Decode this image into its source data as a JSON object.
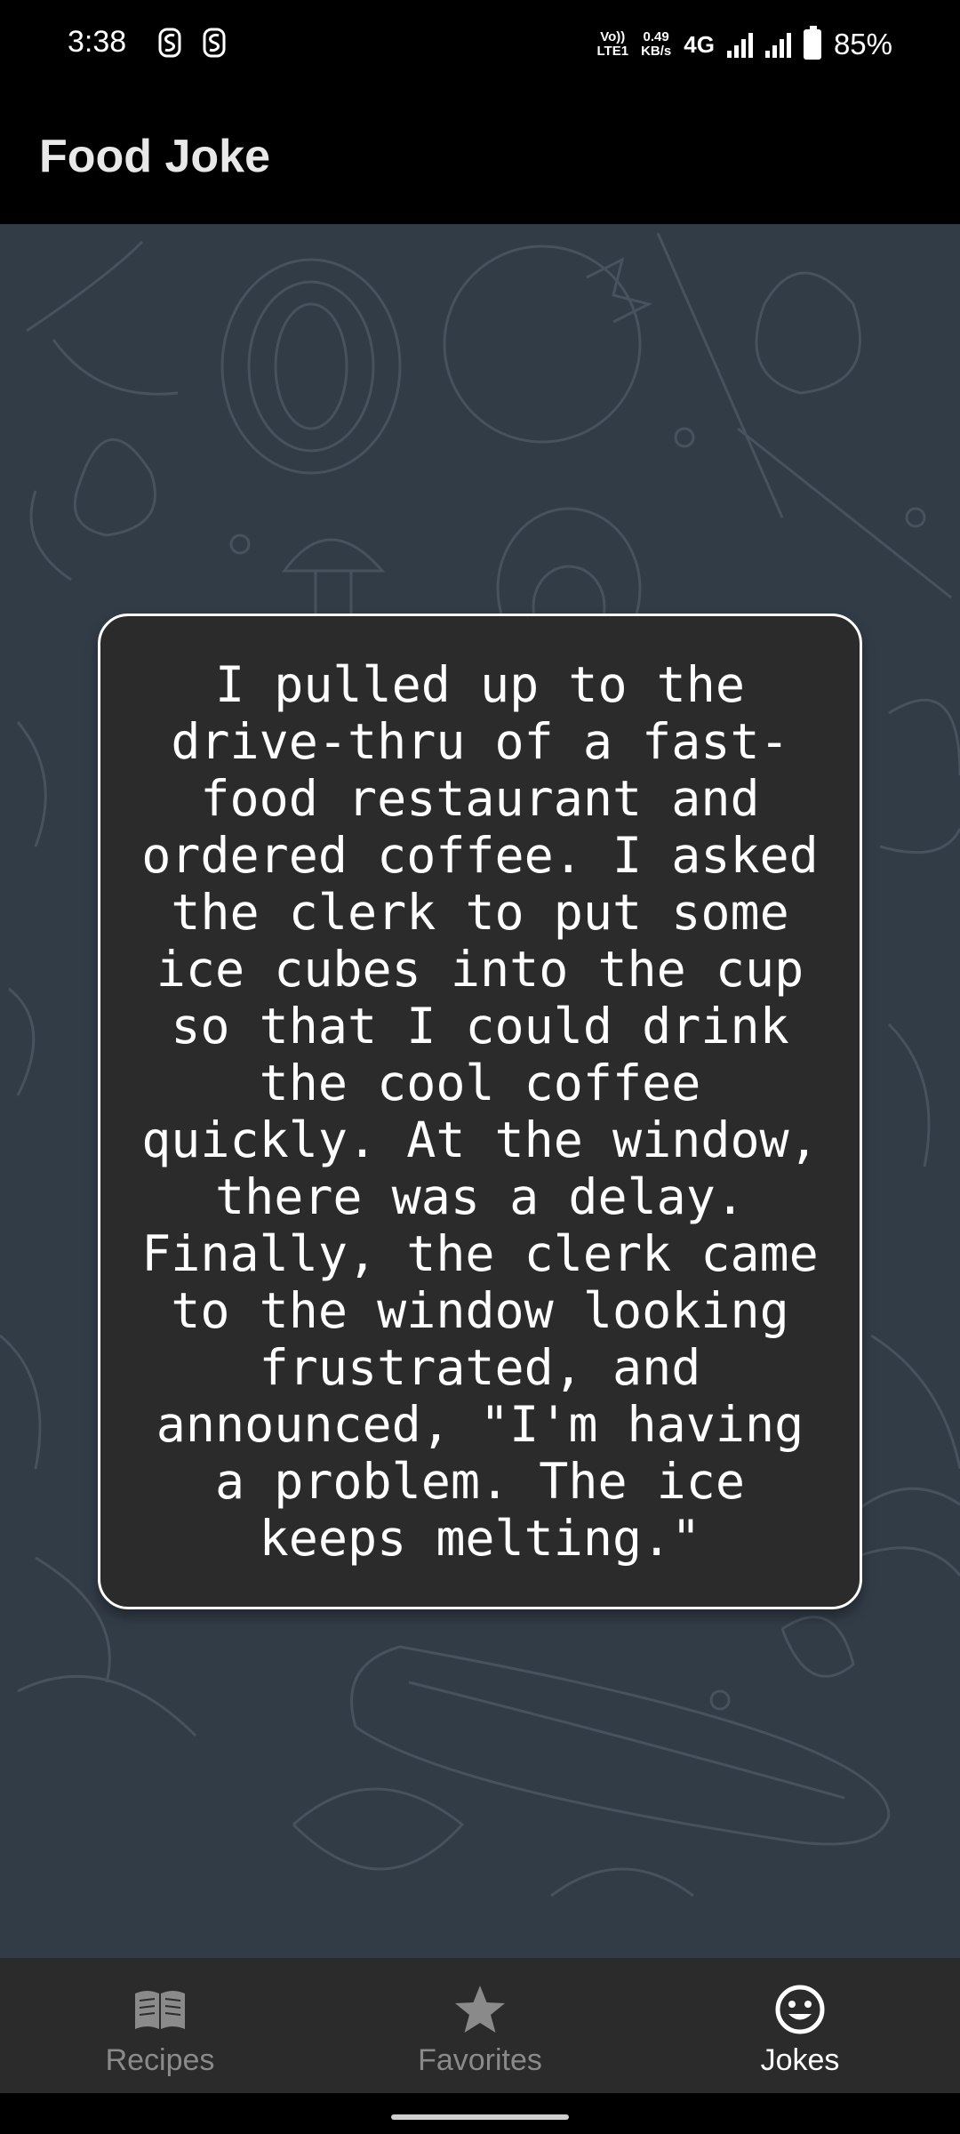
{
  "status_bar": {
    "time": "3:38",
    "volte_top": "Vo))",
    "volte_bottom": "LTE1",
    "speed_value": "0.49",
    "speed_unit": "KB/s",
    "network": "4G",
    "battery_percent": "85%"
  },
  "app_bar": {
    "title": "Food Joke"
  },
  "joke": {
    "text": "I pulled up to the drive-thru of a fast-food restaurant and ordered coffee. I asked the clerk to put some ice cubes into the cup so that I could drink the cool coffee quickly. At the window, there was a delay. Finally, the clerk came to the window looking frustrated, and announced, \"I'm having a problem. The ice keeps melting.\""
  },
  "bottom_nav": {
    "items": [
      {
        "label": "Recipes",
        "icon": "book-icon",
        "active": false
      },
      {
        "label": "Favorites",
        "icon": "star-icon",
        "active": false
      },
      {
        "label": "Jokes",
        "icon": "smiley-icon",
        "active": true
      }
    ]
  },
  "colors": {
    "background": "#323c47",
    "card": "#2b2b2b",
    "nav_bar": "#2b2b2b",
    "inactive": "#8a8a8a",
    "active": "#ffffff"
  }
}
